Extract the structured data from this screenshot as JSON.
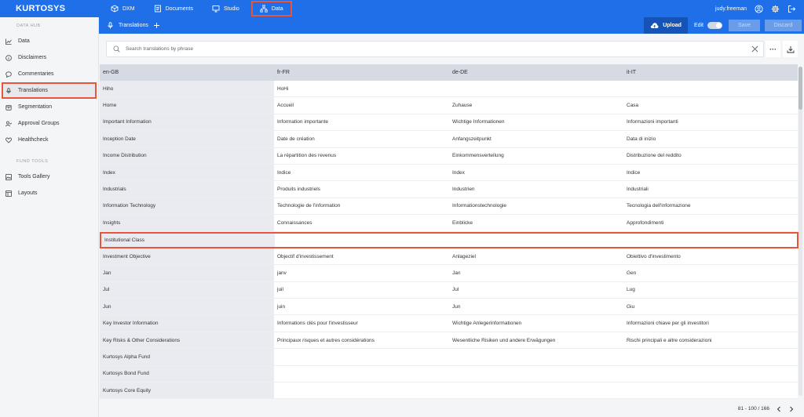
{
  "app": {
    "logo": "KURTOSYS"
  },
  "topnav": [
    {
      "label": "DXM",
      "icon": "cube-icon"
    },
    {
      "label": "Documents",
      "icon": "document-icon"
    },
    {
      "label": "Studio",
      "icon": "monitor-icon"
    },
    {
      "label": "Data",
      "icon": "hierarchy-icon",
      "active": true
    }
  ],
  "user": {
    "name": "judy.freeman"
  },
  "sidebar": {
    "section1": "DATA HUB",
    "items1": [
      {
        "label": "Data",
        "icon": "chart-line-icon"
      },
      {
        "label": "Disclaimers",
        "icon": "info-circle-icon"
      },
      {
        "label": "Commentaries",
        "icon": "chat-bubble-icon"
      },
      {
        "label": "Translations",
        "icon": "microphone-icon",
        "active": true
      },
      {
        "label": "Segmentation",
        "icon": "box-icon"
      },
      {
        "label": "Approval Groups",
        "icon": "user-check-icon"
      },
      {
        "label": "Healthcheck",
        "icon": "heart-icon"
      }
    ],
    "section2": "FUND TOOLS",
    "items2": [
      {
        "label": "Tools Gallery",
        "icon": "image-icon"
      },
      {
        "label": "Layouts",
        "icon": "layout-icon"
      }
    ]
  },
  "subbar": {
    "title": "Translations",
    "upload_label": "Upload",
    "edit_label": "Edit",
    "save_label": "Save",
    "discard_label": "Discard"
  },
  "search": {
    "placeholder": "Search translations by phrase"
  },
  "table": {
    "headers": [
      "en-GB",
      "fr-FR",
      "de-DE",
      "it-IT"
    ],
    "rows": [
      [
        "Hiho",
        "HoHi",
        "",
        ""
      ],
      [
        "Home",
        "Accueil",
        "Zuhause",
        "Casa"
      ],
      [
        "Important Information",
        "Information importante",
        "Wichtige Informationen",
        "Informazioni importanti"
      ],
      [
        "Inception Date",
        "Date de création",
        "Anfangszeitpunkt",
        "Data di inizio"
      ],
      [
        "Income Distribution",
        "La répartition des revenus",
        "Einkommensverteilung",
        "Distribuzione del reddito"
      ],
      [
        "Index",
        "Indice",
        "Index",
        "Indice"
      ],
      [
        "Industrials",
        "Produits industriels",
        "Industrien",
        "Industriali"
      ],
      [
        "Information Technology",
        "Technologie de l'information",
        "Informationstechnologie",
        "Tecnologia dell'informazione"
      ],
      [
        "Insights",
        "Connaissances",
        "Einblicke",
        "Approfondimenti"
      ],
      [
        "Institutional Class",
        "",
        "",
        ""
      ],
      [
        "Investment Objective",
        "Objectif d'investissement",
        "Anlageziel",
        "Obiettivo d'investimento"
      ],
      [
        "Jan",
        "janv",
        "Jan",
        "Gen"
      ],
      [
        "Jul",
        "juil",
        "Jul",
        "Lug"
      ],
      [
        "Jun",
        "juin",
        "Jun",
        "Giu"
      ],
      [
        "Key Investor Information",
        "Informations clés pour l'investisseur",
        "Wichtige Anlegerinformationen",
        "Informazioni chiave per gli investitori"
      ],
      [
        "Key Risks & Other Considerations",
        "Principaux risques et autres considérations",
        "Wesentliche Risiken und andere Erwägungen",
        "Rischi principali e altre considerazioni"
      ],
      [
        "Kurtosys Alpha Fund",
        "",
        "",
        ""
      ],
      [
        "Kurtosys Bond Fund",
        "",
        "",
        ""
      ],
      [
        "Kurtosys Core Equity",
        "",
        "",
        ""
      ]
    ],
    "highlight_row": 9
  },
  "pagination": {
    "text": "81 - 100 / 166"
  }
}
